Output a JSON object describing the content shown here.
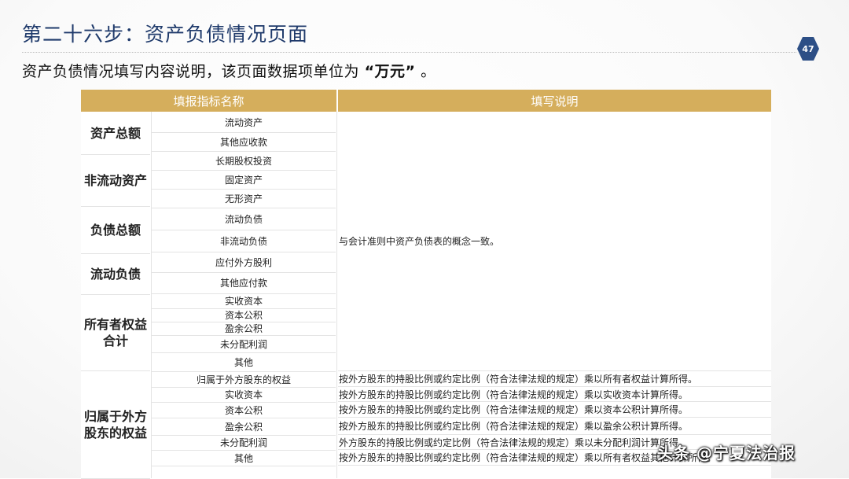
{
  "slide": {
    "title": "第二十六步：资产负债情况页面",
    "page_number": "47",
    "subtitle_prefix": "资产负债情况填写内容说明，该页面数据项单位为",
    "subtitle_unit": "“万元”",
    "subtitle_suffix": "。"
  },
  "table": {
    "headers": [
      "填报指标名称",
      "填写说明"
    ],
    "categories": [
      "资产总额",
      "非流动资产",
      "负债总额",
      "流动负债",
      "所有者权益合计",
      "归属于外方股东的权益"
    ],
    "items": [
      "流动资产",
      "其他应收款",
      "长期股权投资",
      "固定资产",
      "无形资产",
      "流动负债",
      "非流动负债",
      "应付外方股利",
      "其他应付款",
      "实收资本",
      "资本公积",
      "盈余公积",
      "未分配利润",
      "其他",
      "归属于外方股东的权益",
      "实收资本",
      "资本公积",
      "盈余公积",
      "未分配利润",
      "其他"
    ],
    "descriptions": [
      "与会计准则中资产负债表的概念一致。",
      "按外方股东的持股比例或约定比例（符合法律法规的规定）乘以所有者权益计算所得。",
      "按外方股东的持股比例或约定比例（符合法律法规的规定）乘以实收资本计算所得。",
      "按外方股东的持股比例或约定比例（符合法律法规的规定）乘以资本公积计算所得。",
      "按外方股东的持股比例或约定比例（符合法律法规的规定）乘以盈余公积计算所得。",
      "外方股东的持股比例或约定比例（符合法律法规的规定）乘以未分配利润计算所得。",
      "按外方股东的持股比例或约定比例（符合法律法规的规定）乘以所有者权益其他计算所得。"
    ]
  },
  "watermark": {
    "text": "头条 @宁夏法治报"
  },
  "colors": {
    "header_bg": "#d5ae5c",
    "title": "#1f3a6b",
    "page_badge": "#2d4f86"
  }
}
